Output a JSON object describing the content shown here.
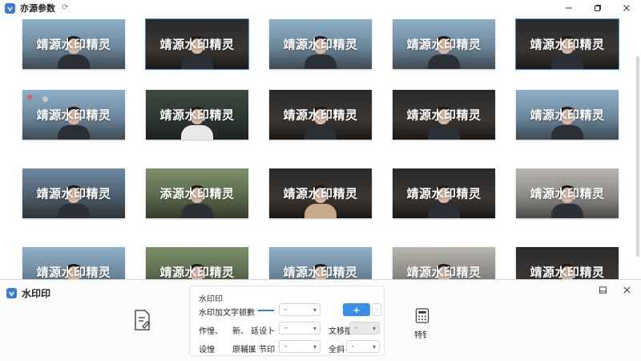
{
  "app": {
    "title": "亦源参数",
    "window_controls": {
      "minimize": "minimize",
      "maximize": "restore",
      "close": "close"
    }
  },
  "gallery": {
    "watermark_text": "靖源水印精灵",
    "thumbnails": [
      {
        "watermark": "靖源水印精灵"
      },
      {
        "watermark": "靖源水印精灵"
      },
      {
        "watermark": "靖源水印精灵"
      },
      {
        "watermark": "靖源水印精灵"
      },
      {
        "watermark": "靖源水印精灵"
      },
      {
        "watermark": "靖源水印精灵"
      },
      {
        "watermark": "靖源水印精灵"
      },
      {
        "watermark": "靖源水印精灵"
      },
      {
        "watermark": "靖源水印精灵"
      },
      {
        "watermark": "靖源水印精灵"
      },
      {
        "watermark": "靖源水印精灵"
      },
      {
        "watermark": "添源水印精灵"
      },
      {
        "watermark": "靖源水印精灵"
      },
      {
        "watermark": "靖源水印精灵"
      },
      {
        "watermark": "靖源水印精灵"
      },
      {
        "watermark": "靖源水印精灵"
      },
      {
        "watermark": "靖源水印精灵"
      },
      {
        "watermark": "靖源水印精灵"
      },
      {
        "watermark": "靖源水印精灵"
      },
      {
        "watermark": "靖源水印精灵"
      }
    ]
  },
  "panel": {
    "title": "水印印",
    "section_title": "水印印",
    "rows": [
      {
        "label": "水印加文字顿數",
        "select1": "-",
        "button": "+",
        "stepper": "-"
      },
      {
        "label": "作惶、",
        "label2": "新、 廷设卜",
        "select1": "-",
        "label3": "文移擅",
        "select2": "-"
      },
      {
        "label": "设惶",
        "label2": "原輔匽 节印",
        "select1": "-",
        "label3": "全斜",
        "select2": "-"
      }
    ],
    "tool_label": "特钅"
  },
  "colors": {
    "accent": "#3a8ee6",
    "heart": "#e05a4f"
  }
}
